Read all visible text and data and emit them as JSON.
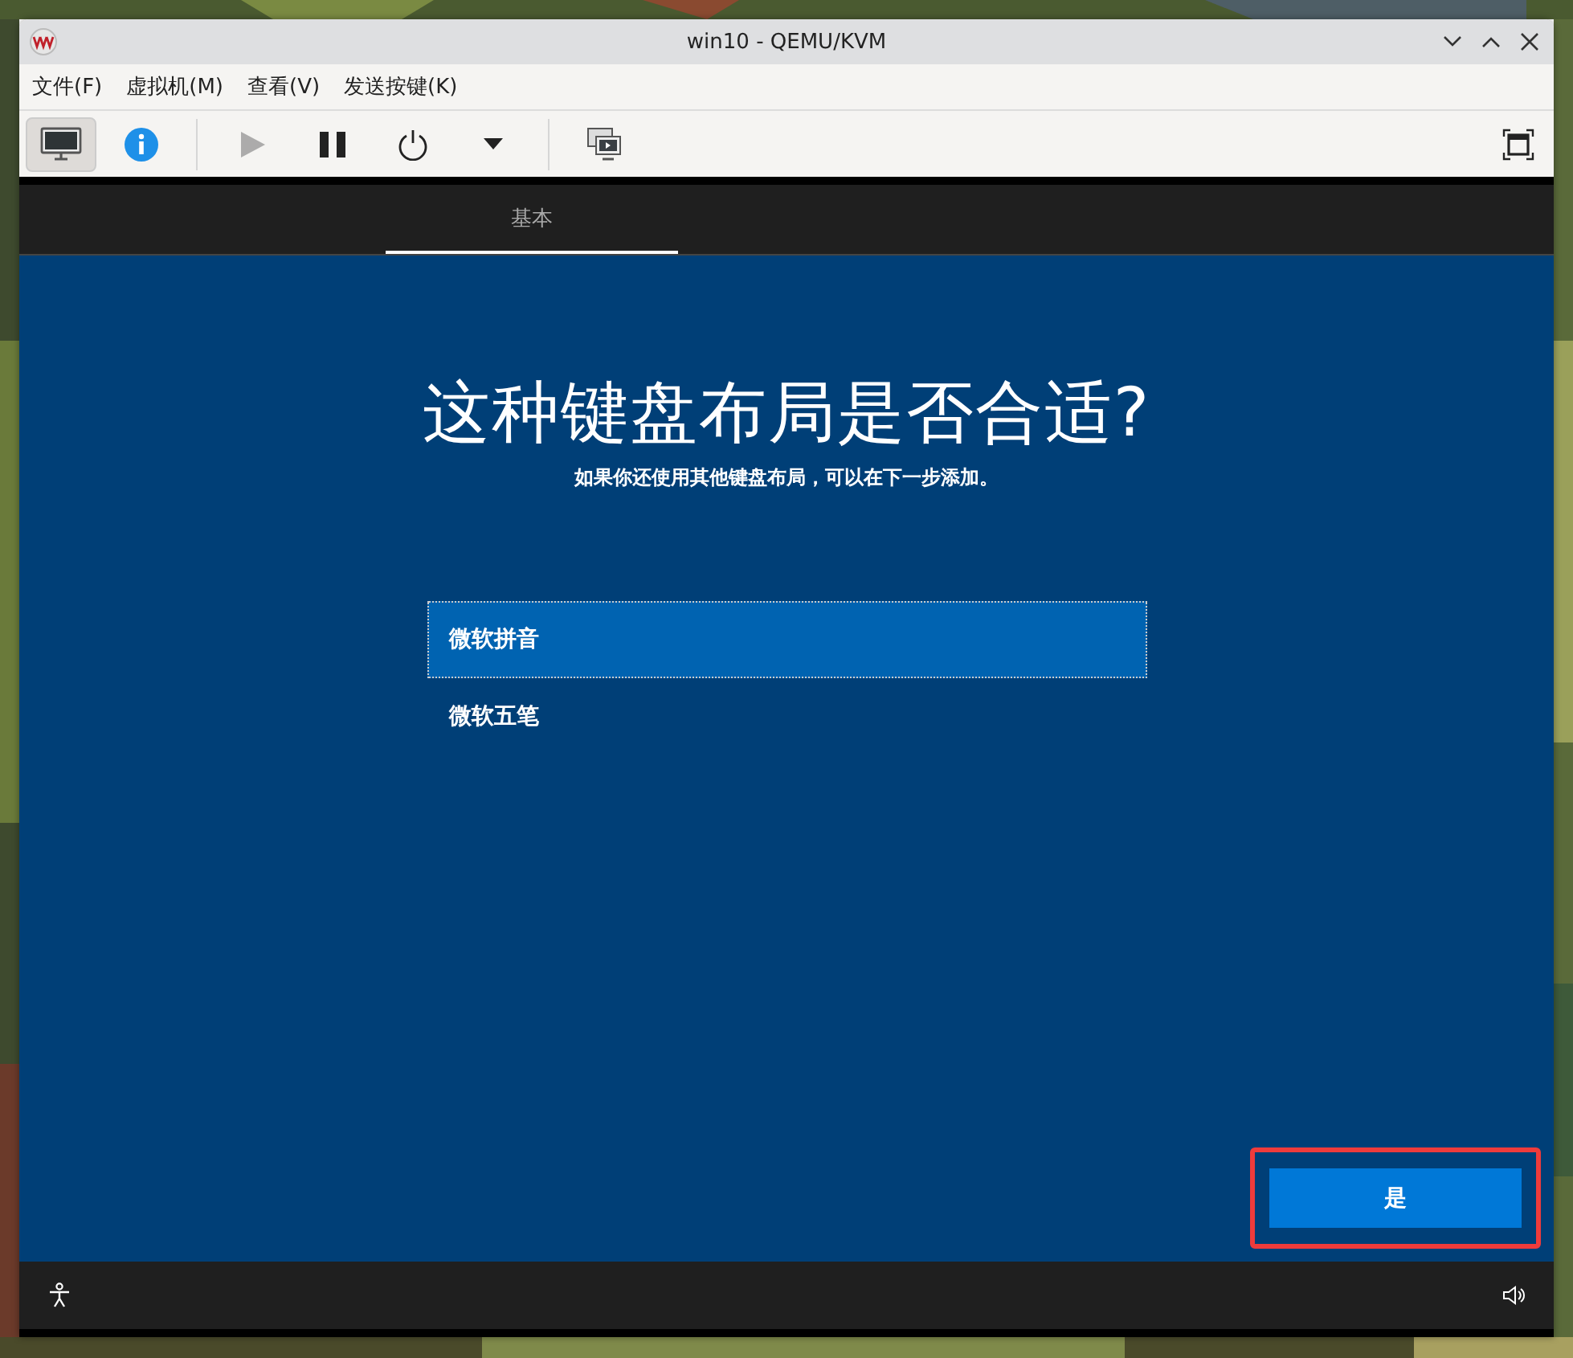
{
  "window": {
    "title": "win10 - QEMU/KVM"
  },
  "menu": [
    "文件(F)",
    "虚拟机(M)",
    "查看(V)",
    "发送按键(K)"
  ],
  "toolbar": [
    {
      "kind": "console",
      "selected": true,
      "disabled": false
    },
    {
      "kind": "info",
      "selected": false,
      "disabled": false
    },
    {
      "kind": "separator"
    },
    {
      "kind": "run",
      "selected": false,
      "disabled": true
    },
    {
      "kind": "pause",
      "selected": false,
      "disabled": false
    },
    {
      "kind": "power",
      "selected": false,
      "disabled": false
    },
    {
      "kind": "dropdown",
      "selected": false,
      "disabled": false
    },
    {
      "kind": "separator"
    },
    {
      "kind": "snapshots",
      "selected": false,
      "disabled": false
    }
  ],
  "guest": {
    "tabs": [
      {
        "label": "基本",
        "selected": true
      }
    ],
    "heading": "这种键盘布局是否合适?",
    "subtitle": "如果你还使用其他键盘布局，可以在下一步添加。",
    "layouts": [
      {
        "label": "微软拼音",
        "selected": true
      },
      {
        "label": "微软五笔",
        "selected": false
      }
    ],
    "confirm_button": {
      "label": "是",
      "highlighted": true
    }
  }
}
